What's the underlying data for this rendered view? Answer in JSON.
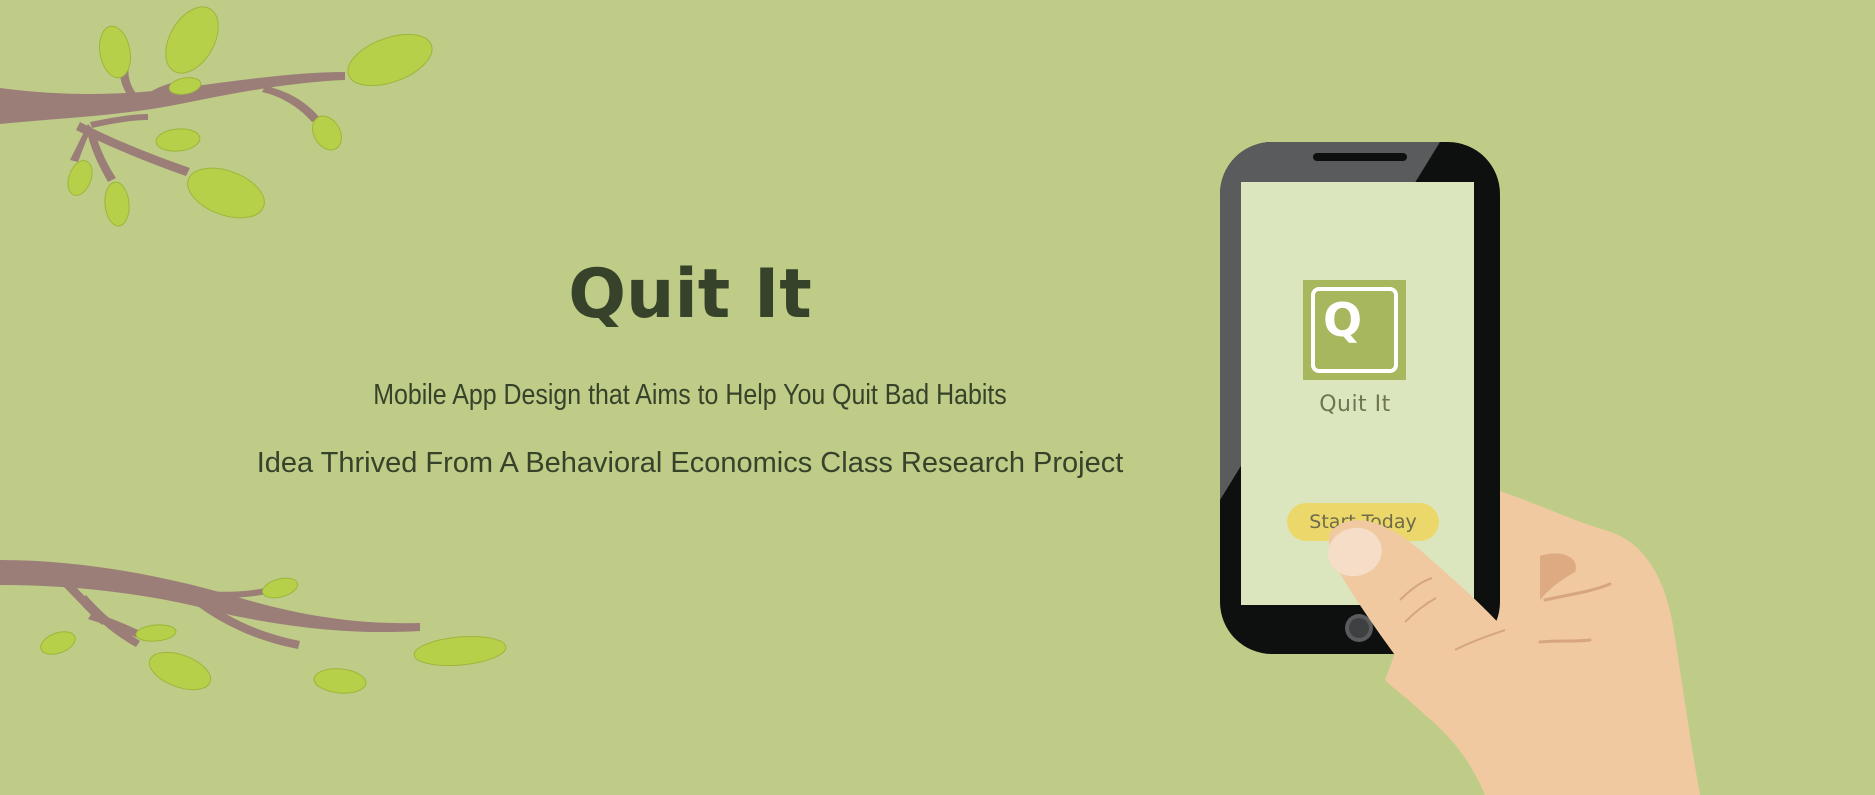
{
  "hero": {
    "title": "Quit It",
    "subtitle": "Mobile App Design that Aims to Help You Quit Bad Habits",
    "tagline": "Idea Thrived From A Behavioral Economics Class Research Project"
  },
  "phone": {
    "app_logo_letter": "Q",
    "app_name": "Quit It",
    "cta_label": "Start Today"
  },
  "colors": {
    "background": "#bfcc87",
    "text_dark": "#36422a",
    "branch": "#9c7e79",
    "leaf": "#b7d04a",
    "phone_body": "#0e100f",
    "screen": "#dbe6be",
    "logo_green": "#a6b75e",
    "button_yellow": "#ecd86a",
    "skin": "#f0c9a1"
  },
  "icons": [
    "tree-branch-top",
    "tree-branch-bottom",
    "app-logo-q-icon",
    "hand-holding-phone"
  ]
}
